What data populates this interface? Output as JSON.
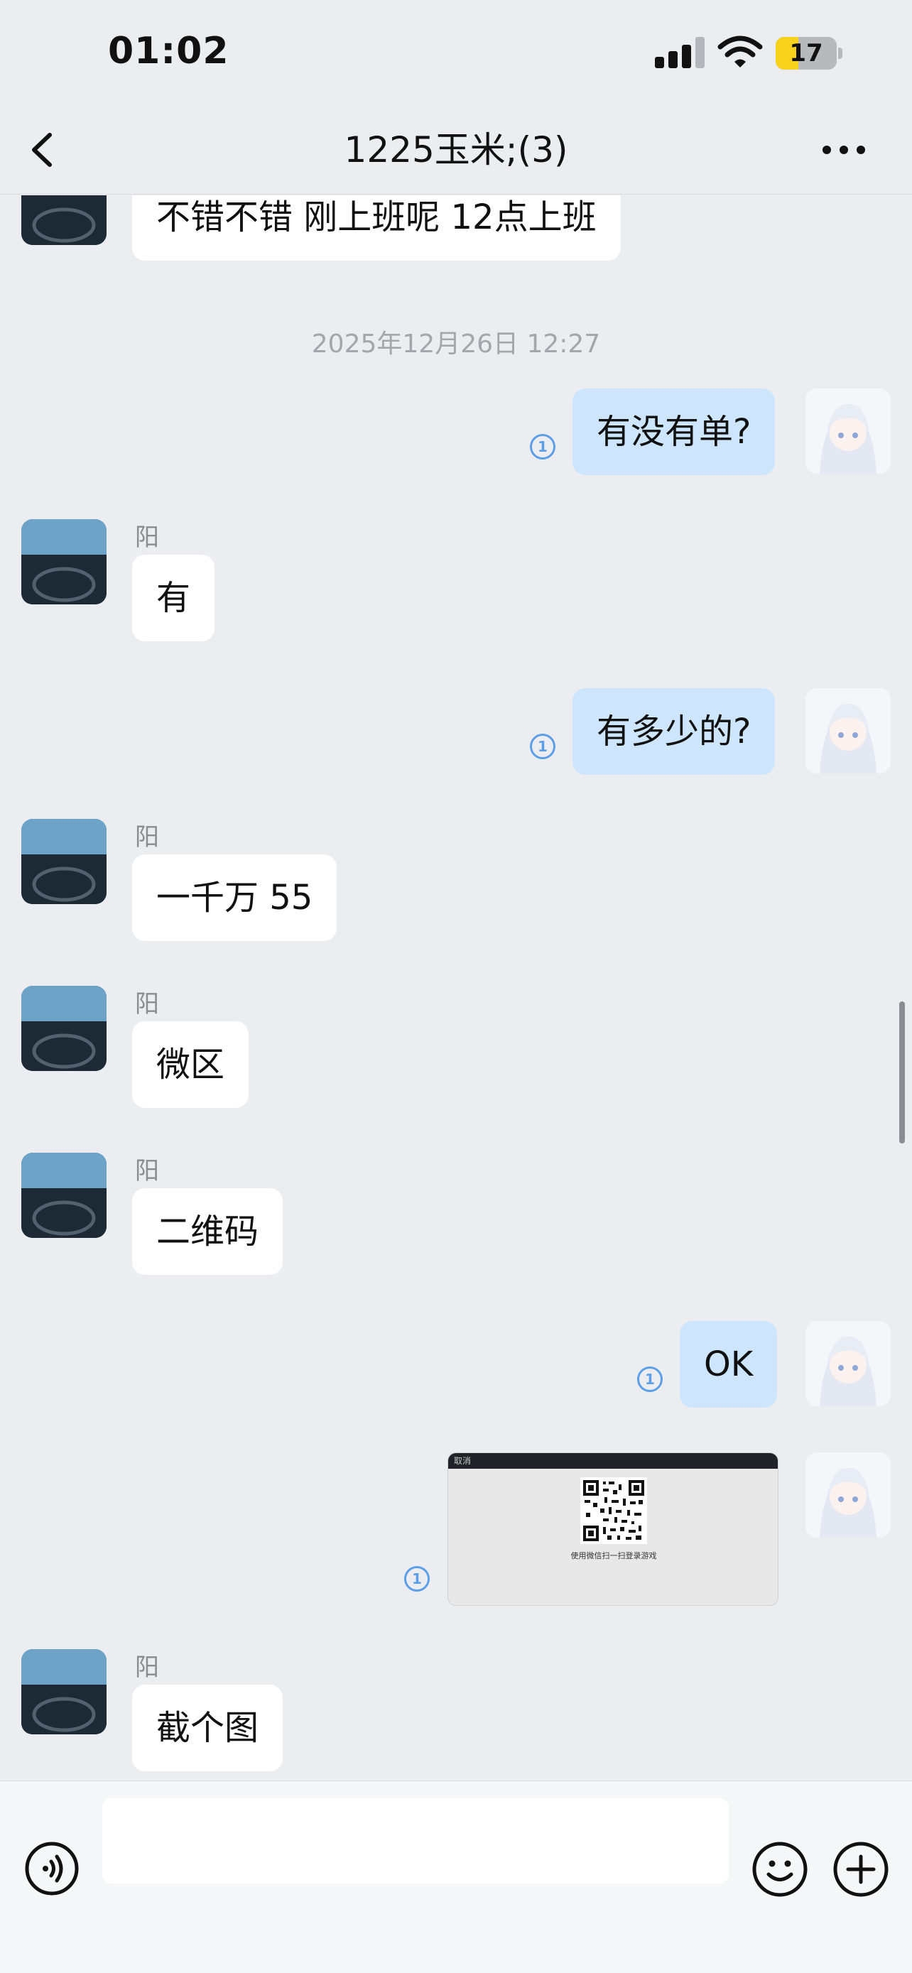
{
  "status_bar": {
    "time": "01:02",
    "battery_level": "17",
    "battery_fraction": 0.17,
    "signal_icon": "cellular-signal-icon",
    "wifi_icon": "wifi-icon"
  },
  "header": {
    "title": "1225玉米;(3)",
    "back_icon": "chevron-left-icon",
    "more_icon": "more-dots-icon"
  },
  "messages": [
    {
      "side": "in",
      "text": "不错不错 刚上班呢 12点上班"
    },
    {
      "type": "timestamp",
      "text": "2025年12月26日 12:27"
    },
    {
      "side": "out",
      "text": "有没有单?",
      "read": "1"
    },
    {
      "side": "in",
      "sender": "阳",
      "text": "有"
    },
    {
      "side": "out",
      "text": "有多少的?",
      "read": "1"
    },
    {
      "side": "in",
      "sender": "阳",
      "text": "一千万 55"
    },
    {
      "side": "in",
      "sender": "阳",
      "text": "微区"
    },
    {
      "side": "in",
      "sender": "阳",
      "text": "二维码"
    },
    {
      "side": "out",
      "text": "OK",
      "read": "1"
    },
    {
      "side": "out",
      "type": "image",
      "image_top_text": "取消",
      "image_caption": "使用微信扫一扫登录游戏",
      "read": "1"
    },
    {
      "side": "in",
      "sender": "阳",
      "text": "截个图"
    }
  ],
  "input_bar": {
    "voice_icon": "voice-icon",
    "emoji_icon": "emoji-icon",
    "plus_icon": "plus-icon",
    "placeholder": ""
  },
  "colors": {
    "background": "#ebedf1",
    "incoming_bubble": "#ffffff",
    "outgoing_bubble": "#cde5fd",
    "read_mark": "#5d9fe6",
    "battery": "#f8d21c"
  }
}
